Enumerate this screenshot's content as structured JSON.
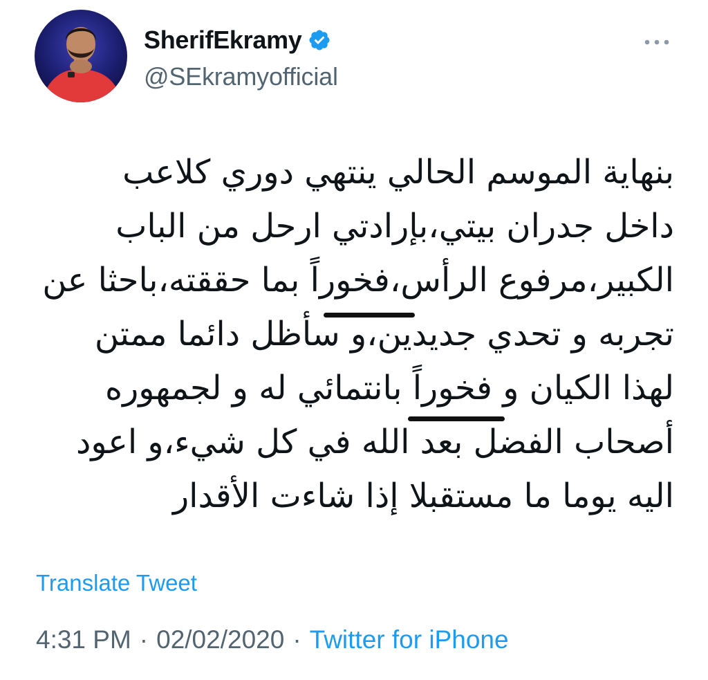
{
  "author": {
    "display_name": "SherifEkramy",
    "handle": "@SEkramyofficial",
    "verified_icon": "verified-badge-icon",
    "avatar_icon": "profile-photo"
  },
  "menu": {
    "more_icon": "more-options-icon"
  },
  "tweet": {
    "lines": [
      "بنهاية الموسم الحالي ينتهي دوري كلاعب",
      "داخل جدران بيتي،بإرادتي ارحل من الباب",
      "الكبير،مرفوع الرأس،فخوراً بما حققته،باحثا عن",
      "تجربه و تحدي جديدين،و سأظل دائما ممتن",
      "لهذا الكيان و فخوراً بانتمائي له و لجمهوره",
      "أصحاب الفضل بعد الله في كل شيء،و اعود",
      "اليه يوما ما مستقبلا إذا شاءت الأقدار"
    ]
  },
  "translate_label": "Translate Tweet",
  "meta": {
    "time": "4:31 PM",
    "separator": "·",
    "date": "02/02/2020",
    "source": "Twitter for iPhone"
  },
  "colors": {
    "link": "#1d9bf0",
    "muted": "#536471",
    "text": "#0f1419"
  }
}
